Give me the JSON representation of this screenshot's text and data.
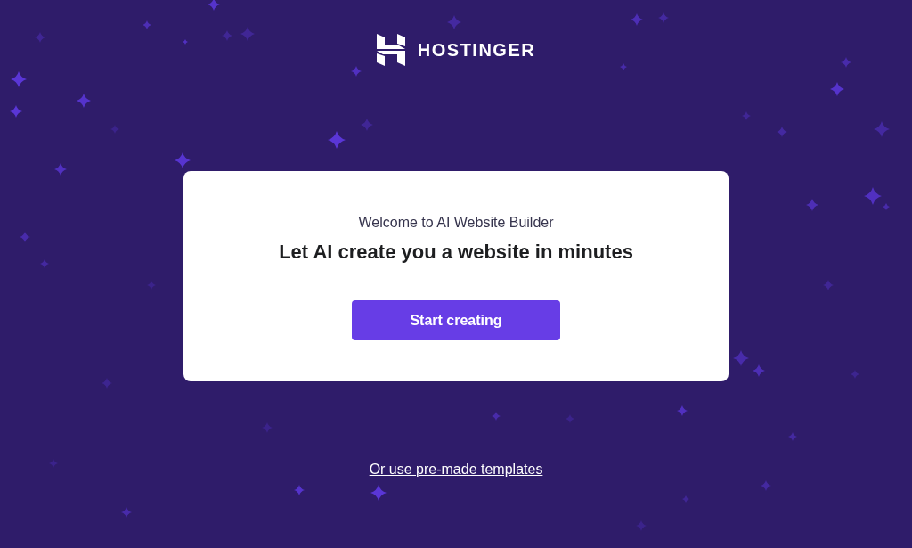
{
  "logo": {
    "text": "HOSTINGER"
  },
  "card": {
    "subtitle": "Welcome to AI Website Builder",
    "title": "Let AI create you a website in minutes",
    "button": "Start creating"
  },
  "link": "Or use pre-made templates"
}
